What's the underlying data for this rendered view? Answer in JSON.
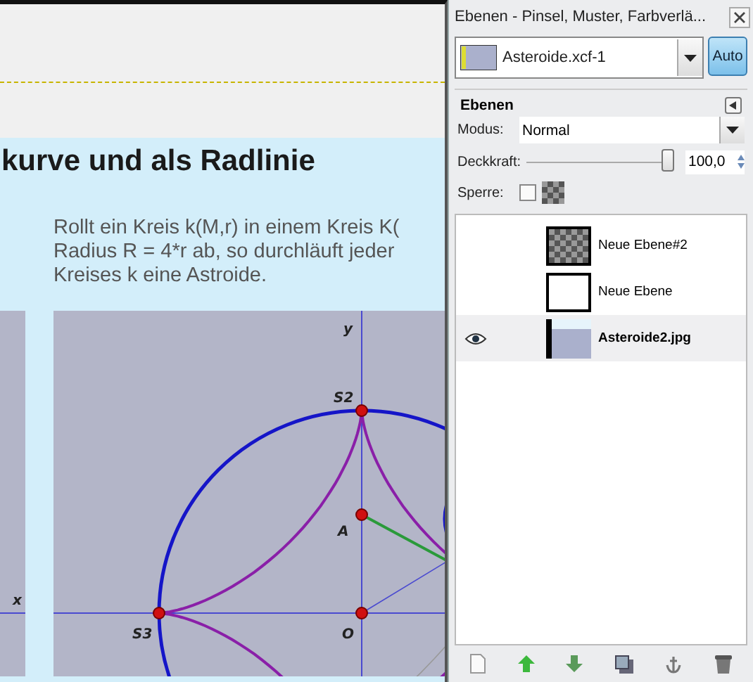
{
  "canvas": {
    "heading": "kurve und als Radlinie",
    "paragraph": [
      "Rollt ein Kreis k(M,r) in einem Kreis K(",
      "Radius R = 4*r ab, so durchläuft jeder",
      "Kreises k eine Astroide."
    ],
    "figure_labels": {
      "left_x": "x",
      "y": "y",
      "s2": "S2",
      "a": "A",
      "o": "O",
      "s3": "S3"
    }
  },
  "panel": {
    "title": "Ebenen - Pinsel, Muster, Farbverlä...",
    "image_menu": {
      "value": "Asteroide.xcf-1",
      "auto": "Auto"
    },
    "section_title": "Ebenen",
    "mode": {
      "label": "Modus:",
      "value": "Normal"
    },
    "opacity": {
      "label": "Deckkraft:",
      "level": 1,
      "value": "100,0"
    },
    "lock": {
      "label": "Sperre:",
      "checked": false
    },
    "layers": [
      {
        "name": "Neue Ebene#2",
        "kind": "transparent",
        "visible": false,
        "selected": false
      },
      {
        "name": "Neue Ebene",
        "kind": "white",
        "visible": false,
        "selected": false
      },
      {
        "name": "Asteroide2.jpg",
        "kind": "image",
        "visible": true,
        "selected": true
      }
    ]
  }
}
